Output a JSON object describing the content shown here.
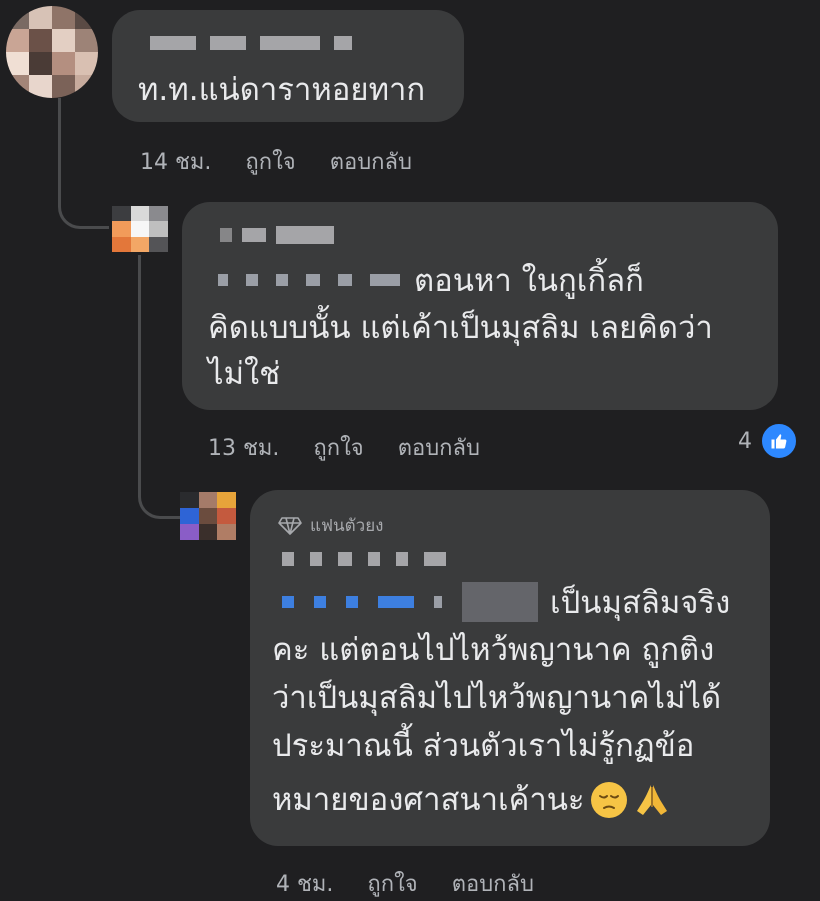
{
  "comments": [
    {
      "text": "ท.ท.แน่ดาราหอยทาก",
      "time": "14 ชม.",
      "like_label": "ถูกใจ",
      "reply_label": "ตอบกลับ"
    },
    {
      "text_line1": "ตอนหา ในกูเกิ้ลก็",
      "text_line2": "คิดแบบนั้น แต่เค้าเป็นมุสลิม เลยคิดว่า",
      "text_line3": "ไม่ใช่",
      "time": "13 ชม.",
      "like_label": "ถูกใจ",
      "reply_label": "ตอบกลับ",
      "reaction_count": "4"
    },
    {
      "badge": "แฟนตัวยง",
      "text_line1": "เป็นมุสลิมจริง",
      "text_line2": "คะ  แต่ตอนไปไหว้พญานาค ถูกติง",
      "text_line3": "ว่าเป็นมุสลิมไปไหว้พญานาคไม่ได้",
      "text_line4": "ประมาณนี้  ส่วนตัวเราไม่รู้กฏข้อ",
      "text_line5": "หมายของศาสนาเค้านะ",
      "time": "4 ชม.",
      "like_label": "ถูกใจ",
      "reply_label": "ตอบกลับ"
    }
  ],
  "colors": {
    "background": "#1f1f21",
    "bubble": "#3a3b3c",
    "like_blue": "#2d88ff"
  }
}
